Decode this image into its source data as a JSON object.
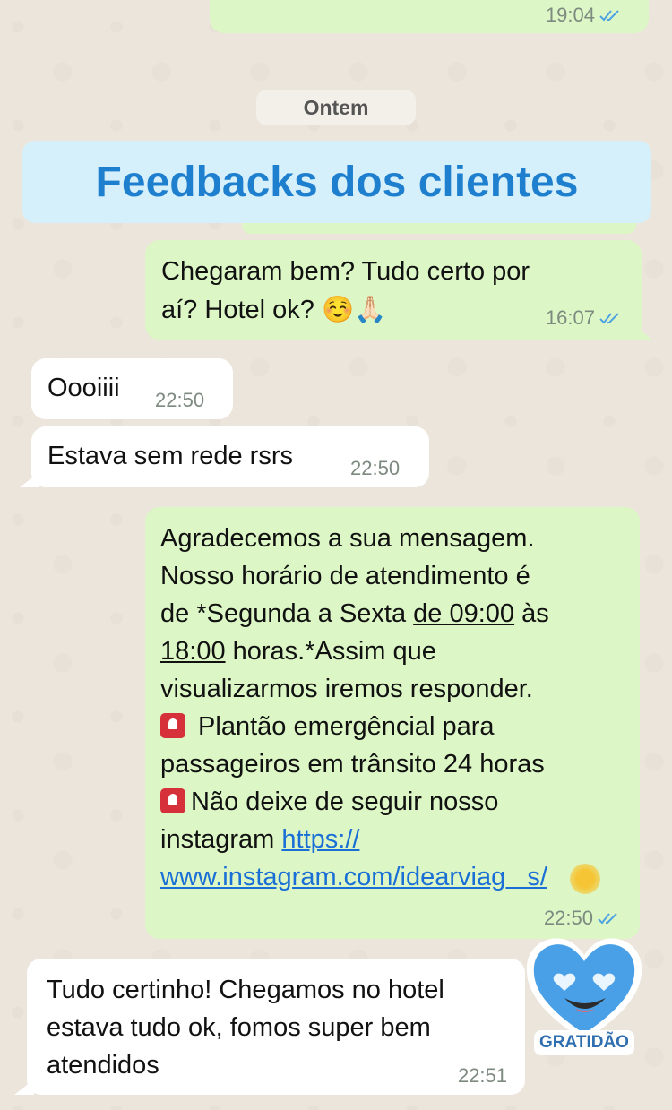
{
  "top_message": {
    "time": "19:04"
  },
  "date_separator": "Ontem",
  "headline": "Feedbacks dos clientes",
  "messages": [
    {
      "line1": "Chegaram bem? Tudo certo por",
      "line2_text": "aí? Hotel ok? ",
      "emoji1": "☺️",
      "emoji2": "🙏🏻",
      "time": "16:07"
    },
    {
      "text": "Oooiiii",
      "time": "22:50"
    },
    {
      "text": "Estava sem rede rsrs",
      "time": "22:50"
    },
    {
      "l1": "Agradecemos a sua mensagem.",
      "l2": "Nosso horário de atendimento é",
      "l3a": "de *Segunda a Sexta ",
      "l3b": "de 09:00",
      "l3c": " às",
      "l4a": "18:00",
      "l4b": " horas.*Assim que",
      "l5": "visualizarmos iremos responder.",
      "l6": " Plantão emergêncial para",
      "l7": "passageiros em trânsito 24 horas",
      "l8": "Não deixe de seguir nosso",
      "l9a": "instagram ",
      "l9b": "https://",
      "l10": "www.instagram.com/idearviag   s/",
      "time": "22:50"
    },
    {
      "l1": "Tudo certinho! Chegamos no hotel",
      "l2": "estava tudo ok, fomos super bem",
      "l3": "atendidos",
      "time": "22:51"
    }
  ],
  "sticker": {
    "label": "GRATIDÃO",
    "icon": "heart-eyes-sticker"
  },
  "colors": {
    "outgoing": "#dcf7c5",
    "incoming": "#ffffff",
    "headline_text": "#1f7fcf",
    "headline_bg": "#d6f0fb",
    "ticks": "#4fa3e3"
  }
}
